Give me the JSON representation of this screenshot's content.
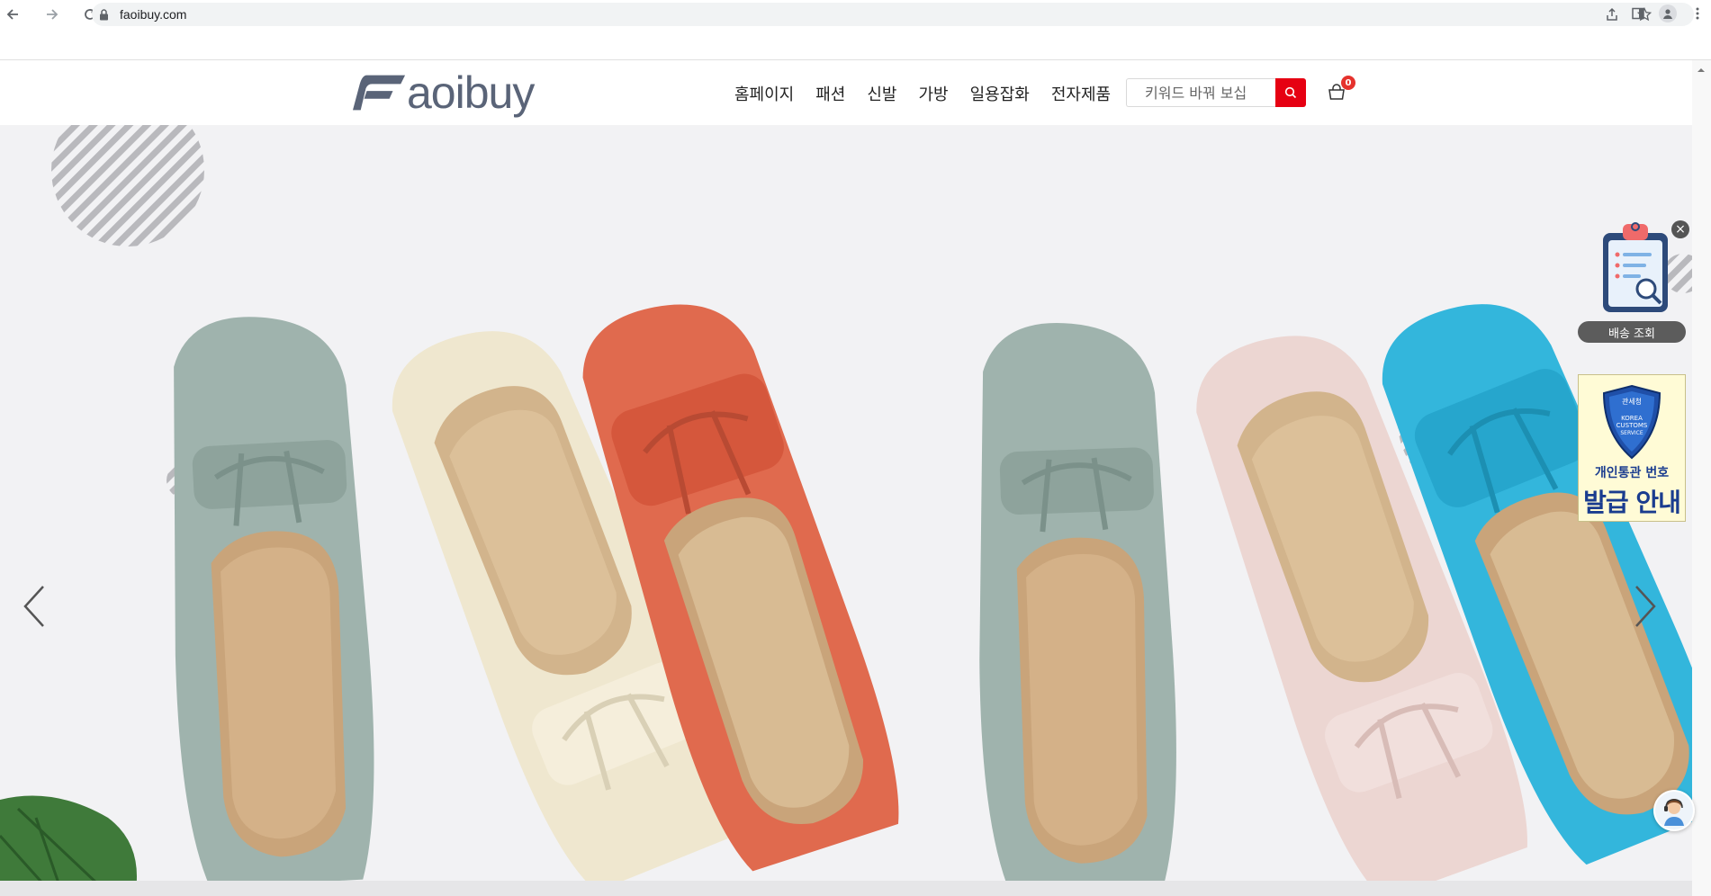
{
  "browser": {
    "url": "faoibuy.com"
  },
  "site": {
    "logo_text": "aoibuy",
    "nav": [
      "홈페이지",
      "패션",
      "신발",
      "가방",
      "일용잡화",
      "전자제품"
    ],
    "search_placeholder": "키워드 바꿔 보십",
    "cart_count": "0"
  },
  "widgets": {
    "delivery_label": "배송 조회",
    "customs_badge_top": "관세청",
    "customs_badge_en1": "KOREA",
    "customs_badge_en2": "CUSTOMS",
    "customs_badge_en3": "SERVICE",
    "customs_line1": "개인통관 번호",
    "customs_line2": "발급 안내"
  },
  "colors": {
    "accent": "#e60012",
    "logo": "#5a6478",
    "badge": "#e5322d",
    "customs_blue": "#1a3c8f"
  }
}
